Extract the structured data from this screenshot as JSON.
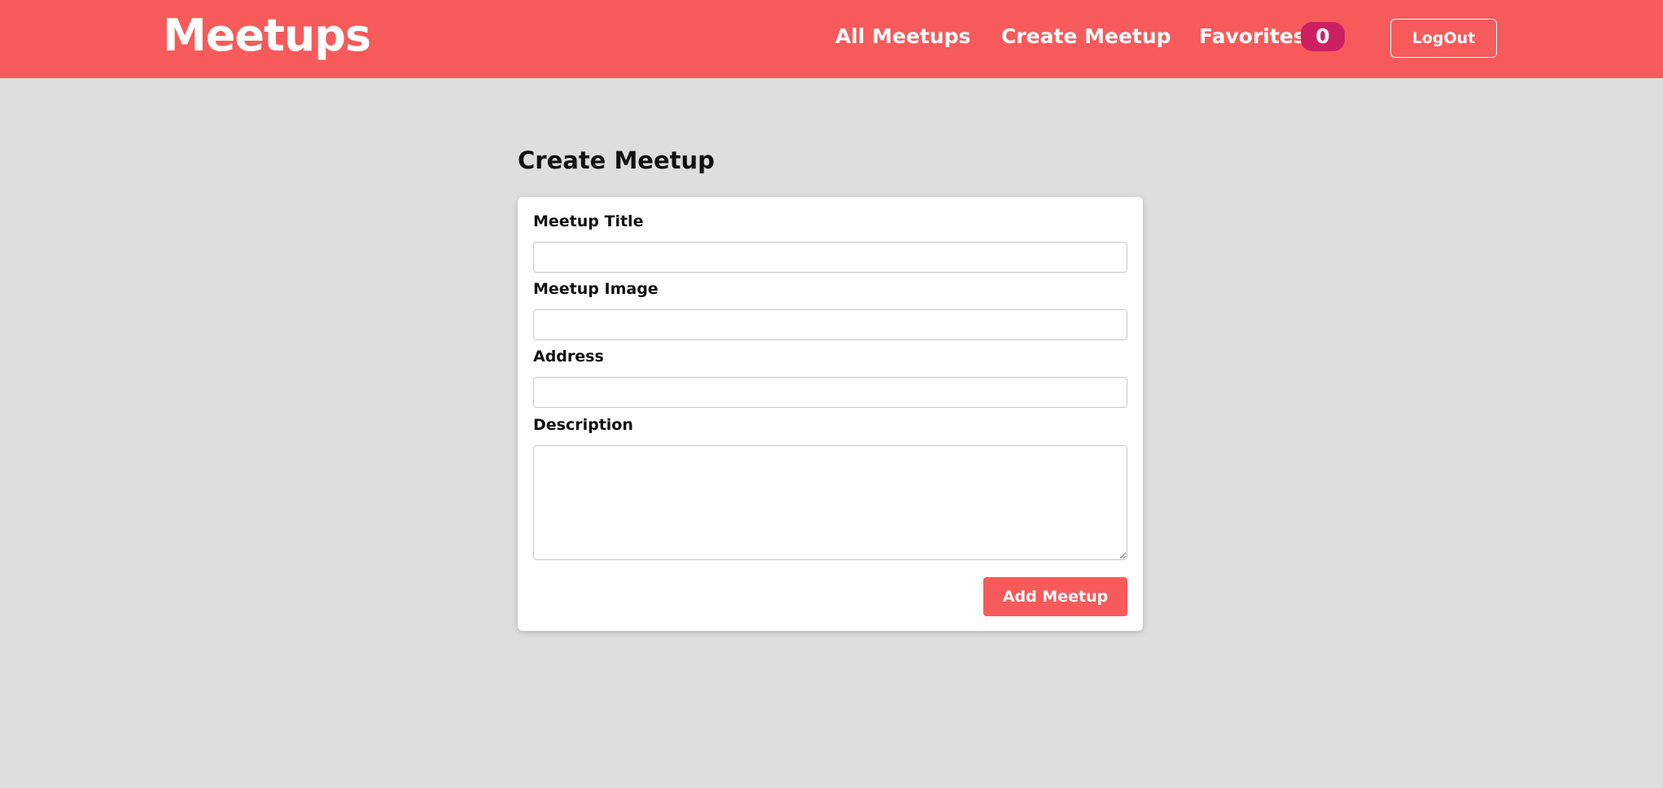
{
  "header": {
    "logo": "Meetups",
    "nav": {
      "all_meetups": "All Meetups",
      "create_meetup": "Create Meetup",
      "favorites": "Favorites",
      "favorites_count": "0"
    },
    "logout_label": "LogOut"
  },
  "main": {
    "page_title": "Create Meetup",
    "form": {
      "title_label": "Meetup Title",
      "title_value": "",
      "image_label": "Meetup Image",
      "image_value": "",
      "address_label": "Address",
      "address_value": "",
      "description_label": "Description",
      "description_value": "",
      "submit_label": "Add Meetup"
    }
  },
  "colors": {
    "brand": "#f75a5a",
    "badge": "#cc2062",
    "background": "#dedede"
  }
}
